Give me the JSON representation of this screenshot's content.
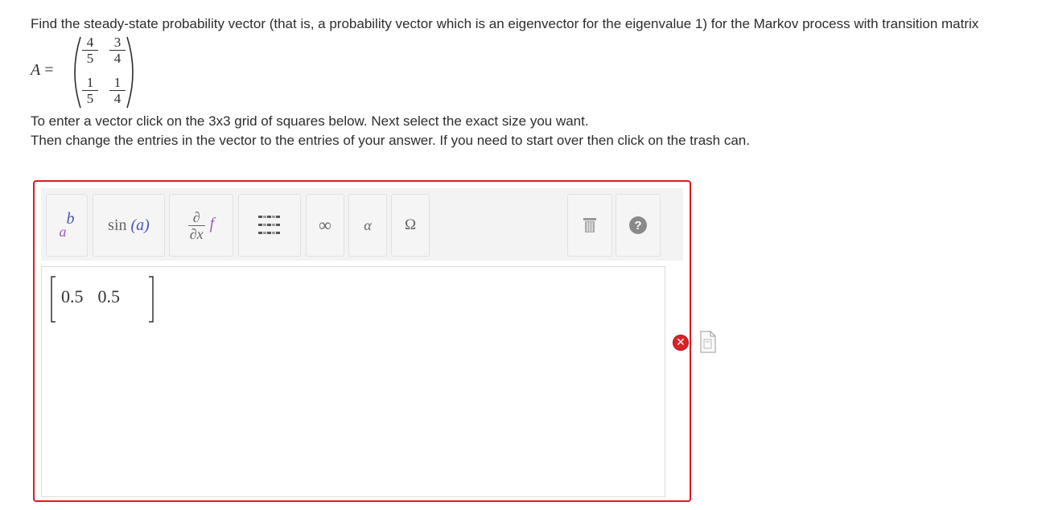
{
  "question": {
    "text": "Find the steady-state probability vector (that is, a probability vector which is an eigenvector for the eigenvalue 1) for the Markov process with transition matrix",
    "matrix_label": "A",
    "matrix_equals": "=",
    "matrix": [
      [
        {
          "num": "4",
          "den": "5"
        },
        {
          "num": "3",
          "den": "4"
        }
      ],
      [
        {
          "num": "1",
          "den": "5"
        },
        {
          "num": "1",
          "den": "4"
        }
      ]
    ],
    "instruction_1": "To enter a vector click on the 3x3 grid of squares below. Next select the exact size you want.",
    "instruction_2": "Then change the entries in the vector to the entries of your answer. If you need to start over then click on the trash can."
  },
  "toolbar": {
    "sup_base": "a",
    "sup_exp": "b",
    "sin_label": "sin",
    "sin_arg": "(a)",
    "deriv_num": "∂",
    "deriv_den": "∂x",
    "deriv_fn": "f",
    "infinity_label": "∞",
    "alpha_label": "α",
    "omega_label": "Ω",
    "help_label": "?"
  },
  "answer": {
    "entries": [
      "0.5",
      "0.5"
    ]
  },
  "status": {
    "incorrect_symbol": "✕"
  },
  "colors": {
    "error_border": "#e0191f",
    "toolbar_bg": "#f3f3f3",
    "text": "#2d2d2d"
  }
}
